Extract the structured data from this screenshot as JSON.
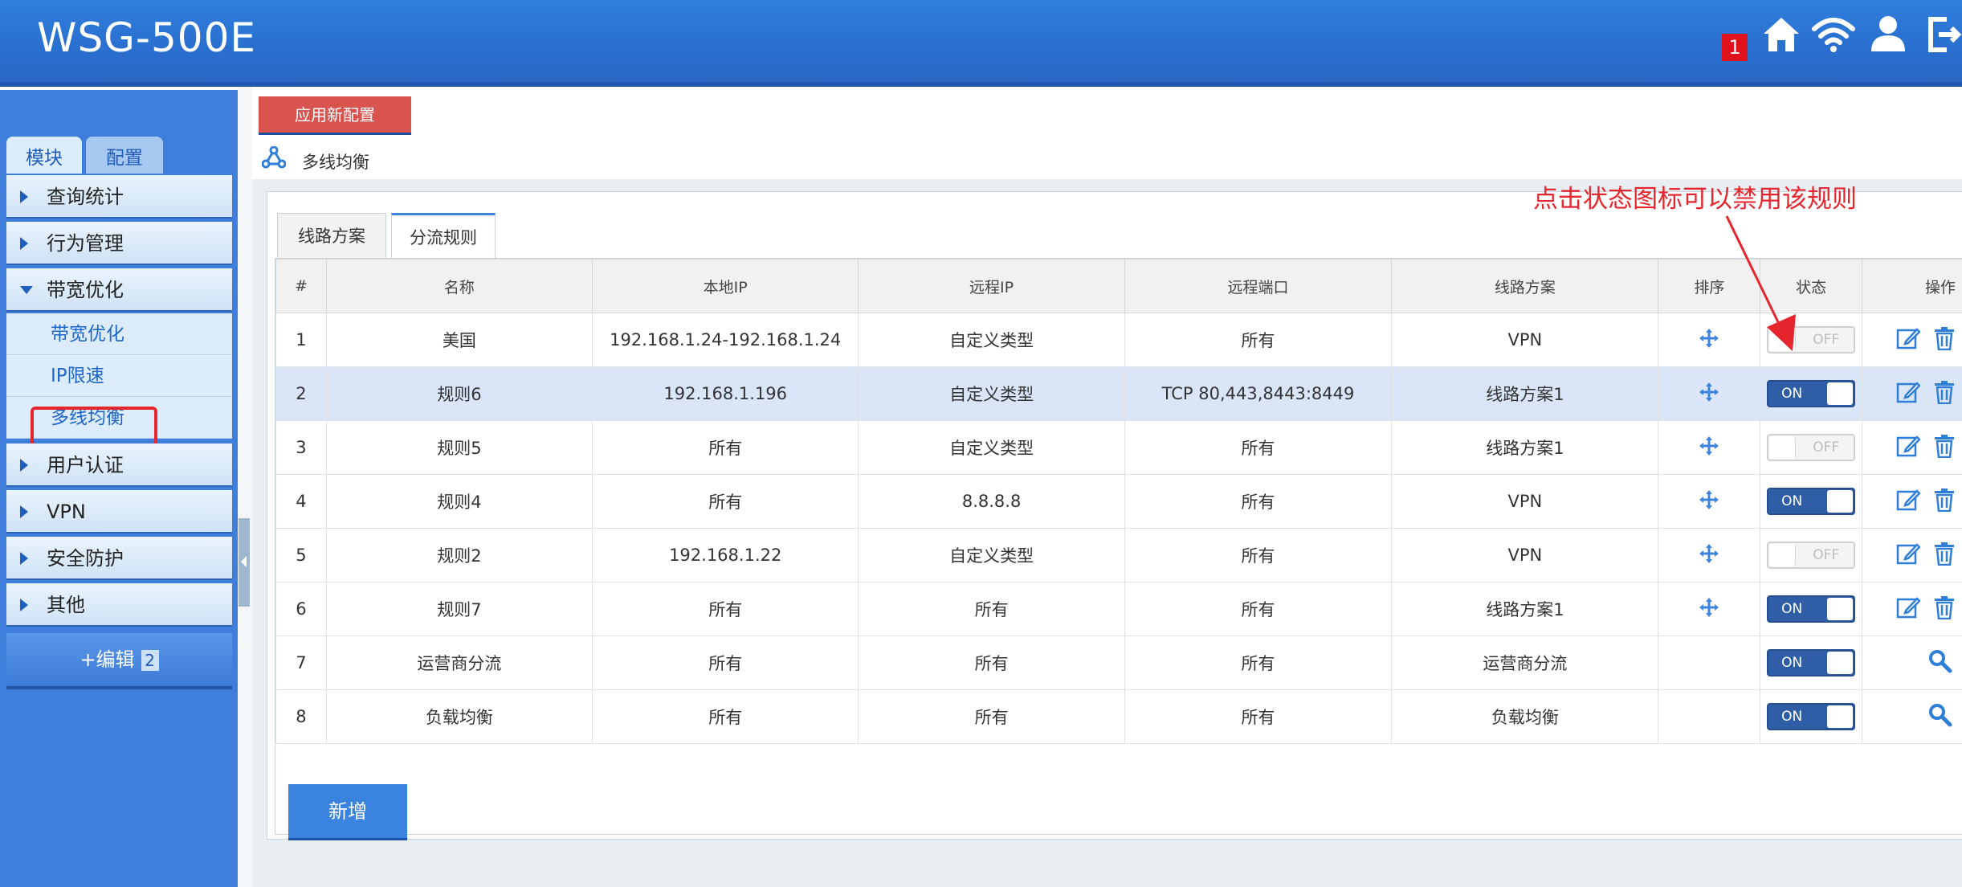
{
  "header": {
    "title": "WSG-500E",
    "notification_count": "1",
    "icons": [
      "home-icon",
      "wifi-icon",
      "user-icon",
      "logout-icon"
    ]
  },
  "sidebar": {
    "tabs": [
      "模块",
      "配置"
    ],
    "menu": [
      {
        "label": "查询统计"
      },
      {
        "label": "行为管理"
      },
      {
        "label": "带宽优化",
        "expanded": true,
        "children": [
          "带宽优化",
          "IP限速",
          "多线均衡"
        ]
      },
      {
        "label": "用户认证"
      },
      {
        "label": "VPN"
      },
      {
        "label": "安全防护"
      },
      {
        "label": "其他"
      }
    ],
    "edit_button": {
      "label": "+编辑",
      "count": "2"
    }
  },
  "main": {
    "apply_button": "应用新配置",
    "breadcrumb": "多线均衡",
    "tabs": [
      "线路方案",
      "分流规则"
    ],
    "active_tab": "分流规则",
    "table": {
      "headers": [
        "#",
        "名称",
        "本地IP",
        "远程IP",
        "远程端口",
        "线路方案",
        "排序",
        "状态",
        "操作"
      ],
      "rows": [
        {
          "num": "1",
          "name": "美国",
          "local_ip": "192.168.1.24-192.168.1.24",
          "remote_ip": "自定义类型",
          "remote_port": "所有",
          "plan": "VPN",
          "status": "OFF"
        },
        {
          "num": "2",
          "name": "规则6",
          "local_ip": "192.168.1.196",
          "remote_ip": "自定义类型",
          "remote_port": "TCP   80,443,8443:8449",
          "plan": "线路方案1",
          "status": "ON"
        },
        {
          "num": "3",
          "name": "规则5",
          "local_ip": "所有",
          "remote_ip": "自定义类型",
          "remote_port": "所有",
          "plan": "线路方案1",
          "status": "OFF"
        },
        {
          "num": "4",
          "name": "规则4",
          "local_ip": "所有",
          "remote_ip": "8.8.8.8",
          "remote_port": "所有",
          "plan": "VPN",
          "status": "ON"
        },
        {
          "num": "5",
          "name": "规则2",
          "local_ip": "192.168.1.22",
          "remote_ip": "自定义类型",
          "remote_port": "所有",
          "plan": "VPN",
          "status": "OFF"
        },
        {
          "num": "6",
          "name": "规则7",
          "local_ip": "所有",
          "remote_ip": "所有",
          "remote_port": "所有",
          "plan": "线路方案1",
          "status": "ON"
        },
        {
          "num": "7",
          "name": "运营商分流",
          "local_ip": "所有",
          "remote_ip": "所有",
          "remote_port": "所有",
          "plan": "运营商分流",
          "status": "ON"
        },
        {
          "num": "8",
          "name": "负载均衡",
          "local_ip": "所有",
          "remote_ip": "所有",
          "remote_port": "所有",
          "plan": "负载均衡",
          "status": "ON"
        }
      ]
    },
    "add_button": "新增",
    "annotation": "点击状态图标可以禁用该规则"
  },
  "colors": {
    "header_blue": "#2a6fcf",
    "sidebar_blue": "#3f7fdb",
    "annotation_red": "#e5262e",
    "apply_red": "#d9534f"
  }
}
